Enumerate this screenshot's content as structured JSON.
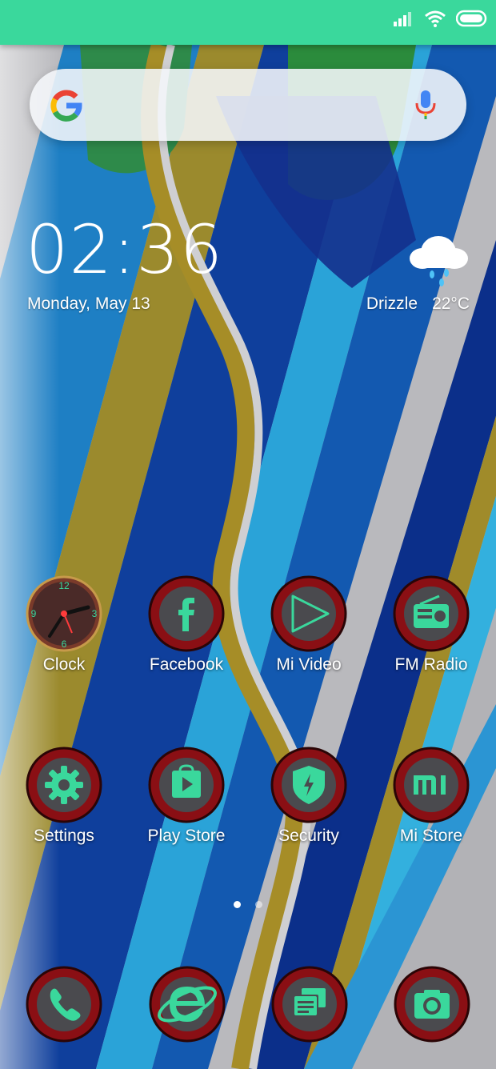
{
  "colors": {
    "statusbar": "#3ad89c",
    "icon_green": "#3ad89c",
    "icon_ring": "#8a0f14"
  },
  "status_bar": {
    "icons": [
      "signal-icon",
      "wifi-icon",
      "battery-icon"
    ]
  },
  "search": {
    "logo": "google-logo-icon",
    "voice": "mic-icon"
  },
  "clock": {
    "time": "02:36",
    "date": "Monday, May 13"
  },
  "weather": {
    "condition": "Drizzle",
    "temperature": "22°C",
    "icon": "drizzle-cloud-icon"
  },
  "apps": [
    {
      "label": "Clock",
      "icon": "analog-clock-icon"
    },
    {
      "label": "Facebook",
      "icon": "facebook-icon"
    },
    {
      "label": "Mi Video",
      "icon": "play-icon"
    },
    {
      "label": "FM Radio",
      "icon": "radio-icon"
    },
    {
      "label": "Settings",
      "icon": "gear-icon"
    },
    {
      "label": "Play Store",
      "icon": "play-store-icon"
    },
    {
      "label": "Security",
      "icon": "shield-icon"
    },
    {
      "label": "Mi Store",
      "icon": "mi-icon"
    }
  ],
  "clock_face_numbers": [
    "12",
    "3",
    "6",
    "9"
  ],
  "pager": {
    "pages": 2,
    "active": 1
  },
  "dock": [
    {
      "icon": "phone-icon"
    },
    {
      "icon": "browser-icon"
    },
    {
      "icon": "messages-icon"
    },
    {
      "icon": "camera-icon"
    }
  ]
}
